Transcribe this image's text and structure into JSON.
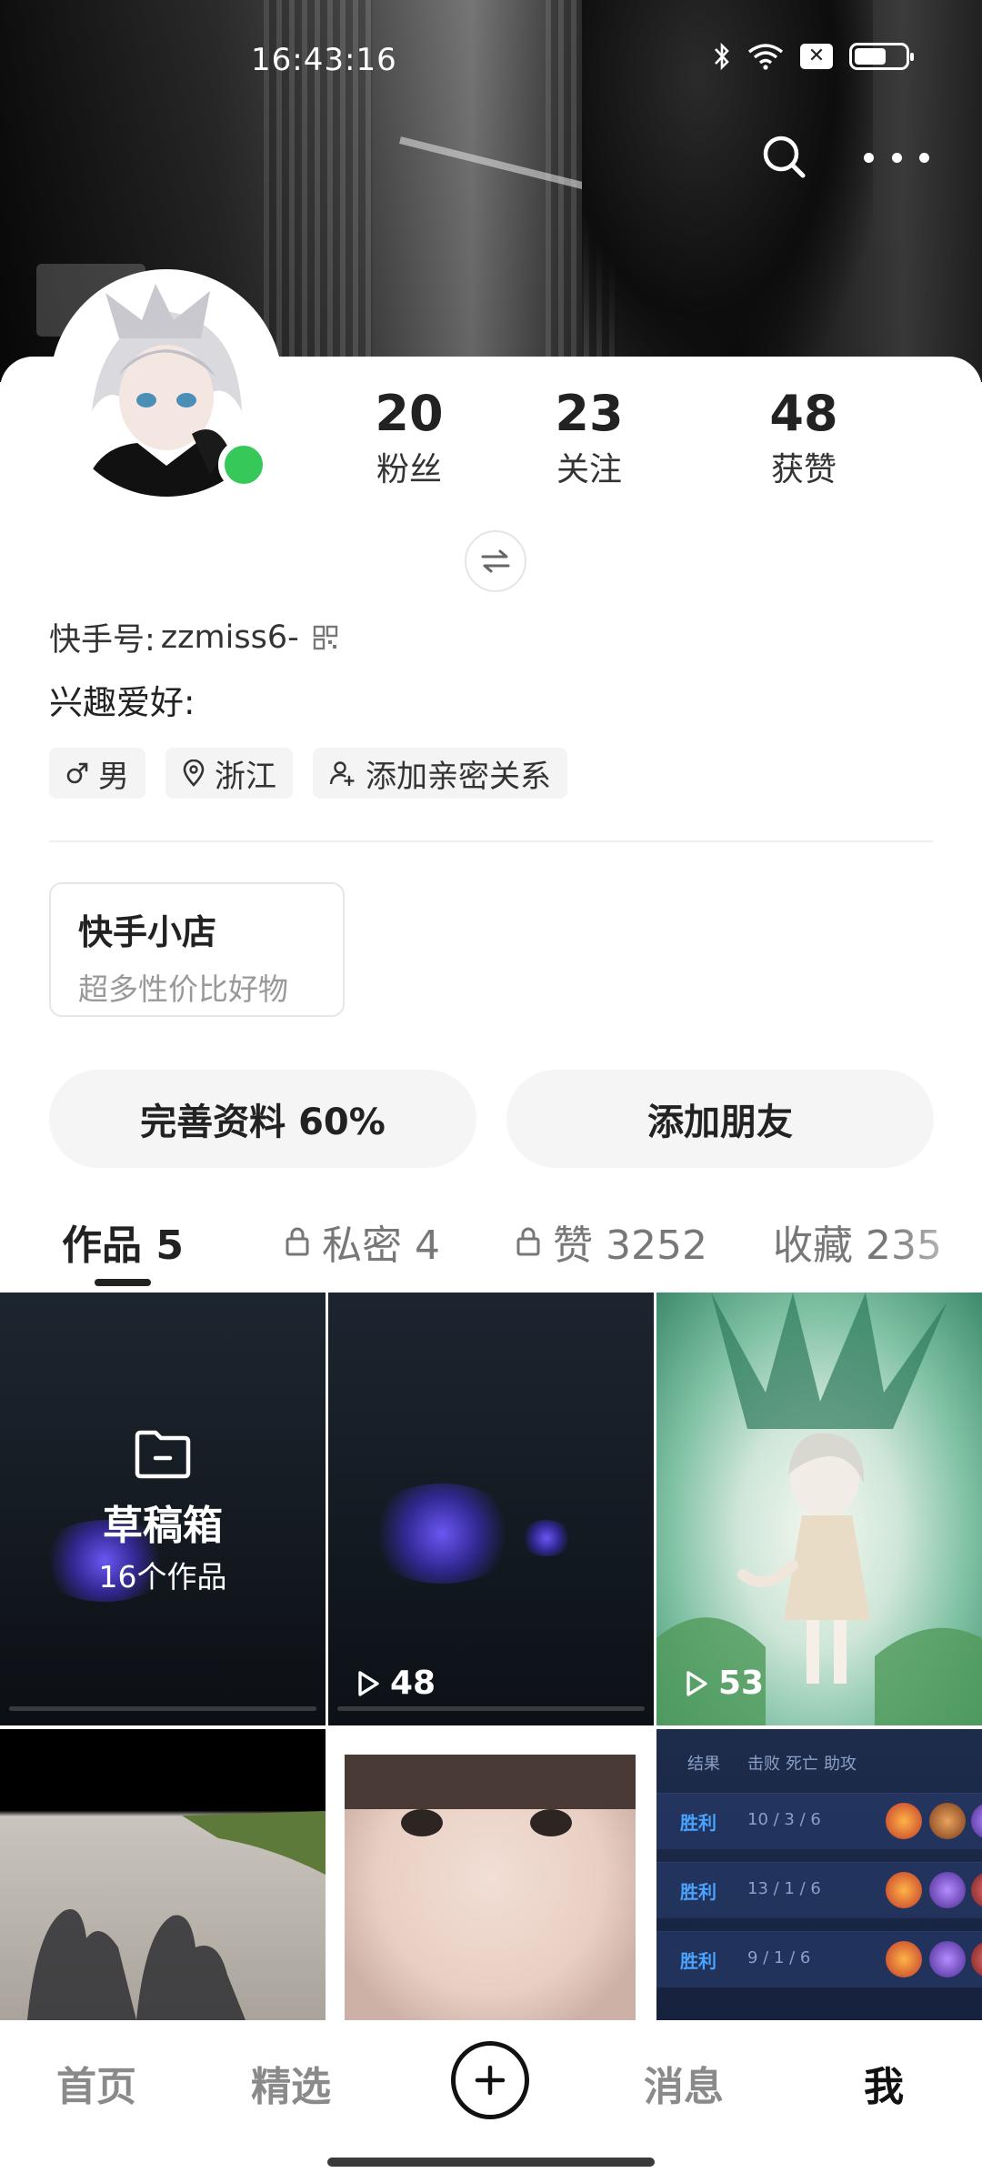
{
  "status_bar": {
    "time": "16:43:16"
  },
  "profile": {
    "stats": [
      {
        "value": "20",
        "label": "粉丝"
      },
      {
        "value": "23",
        "label": "关注"
      },
      {
        "value": "48",
        "label": "获赞"
      }
    ],
    "kuaishou_id_label": "快手号:",
    "kuaishou_id": "zzmiss6-",
    "interests_label": "兴趣爱好:",
    "tags": [
      {
        "icon": "male-icon",
        "label": "男"
      },
      {
        "icon": "location-icon",
        "label": "浙江"
      },
      {
        "icon": "add-person-icon",
        "label": "添加亲密关系"
      }
    ]
  },
  "shop": {
    "title": "快手小店",
    "subtitle": "超多性价比好物"
  },
  "actions": {
    "complete_profile": "完善资料 60%",
    "add_friends": "添加朋友"
  },
  "tabs": [
    {
      "label": "作品 5",
      "locked": false,
      "active": true
    },
    {
      "label": "私密 4",
      "locked": true,
      "active": false
    },
    {
      "label": "赞 3252",
      "locked": true,
      "active": false
    },
    {
      "label": "收藏 235",
      "locked": false,
      "active": false
    }
  ],
  "grid": {
    "drafts": {
      "title": "草稿箱",
      "count": "16个作品"
    },
    "items": [
      {
        "plays": "48"
      },
      {
        "plays": "53"
      }
    ],
    "scoreboard": {
      "header": [
        "结果",
        "击败",
        "死亡",
        "助攻"
      ],
      "rows": [
        {
          "result": "胜利",
          "kda": "10 / 3 / 6"
        },
        {
          "result": "胜利",
          "kda": "13 / 1 / 6"
        },
        {
          "result": "胜利",
          "kda": "9 / 1 / 6"
        }
      ]
    }
  },
  "bottom_nav": {
    "home": "首页",
    "featured": "精选",
    "messages": "消息",
    "me": "我"
  }
}
